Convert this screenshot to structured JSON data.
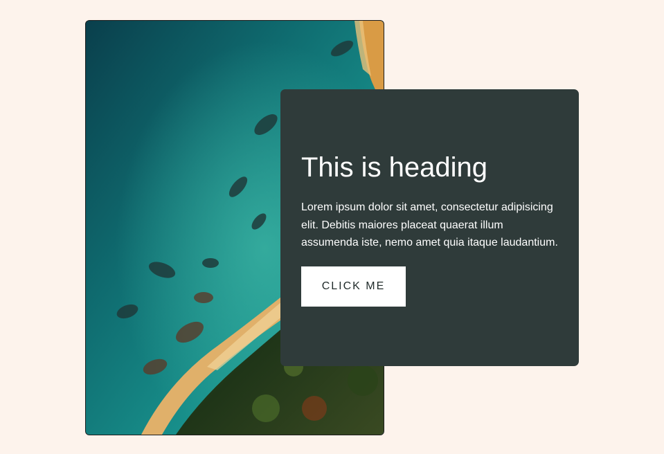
{
  "card": {
    "heading": "This is heading",
    "body": "Lorem ipsum dolor sit amet, consectetur adipisicing elit. Debitis maiores placeat quaerat illum assumenda iste, nemo amet quia itaque laudantium.",
    "button_label": "CLICK ME"
  },
  "colors": {
    "page_background": "#fdf3ec",
    "card_background": "#2f3b3a",
    "button_background": "#ffffff",
    "button_text": "#1f2a29"
  },
  "image": {
    "subject": "aerial coastline photo with turquoise sea, sandy beach and forest"
  }
}
